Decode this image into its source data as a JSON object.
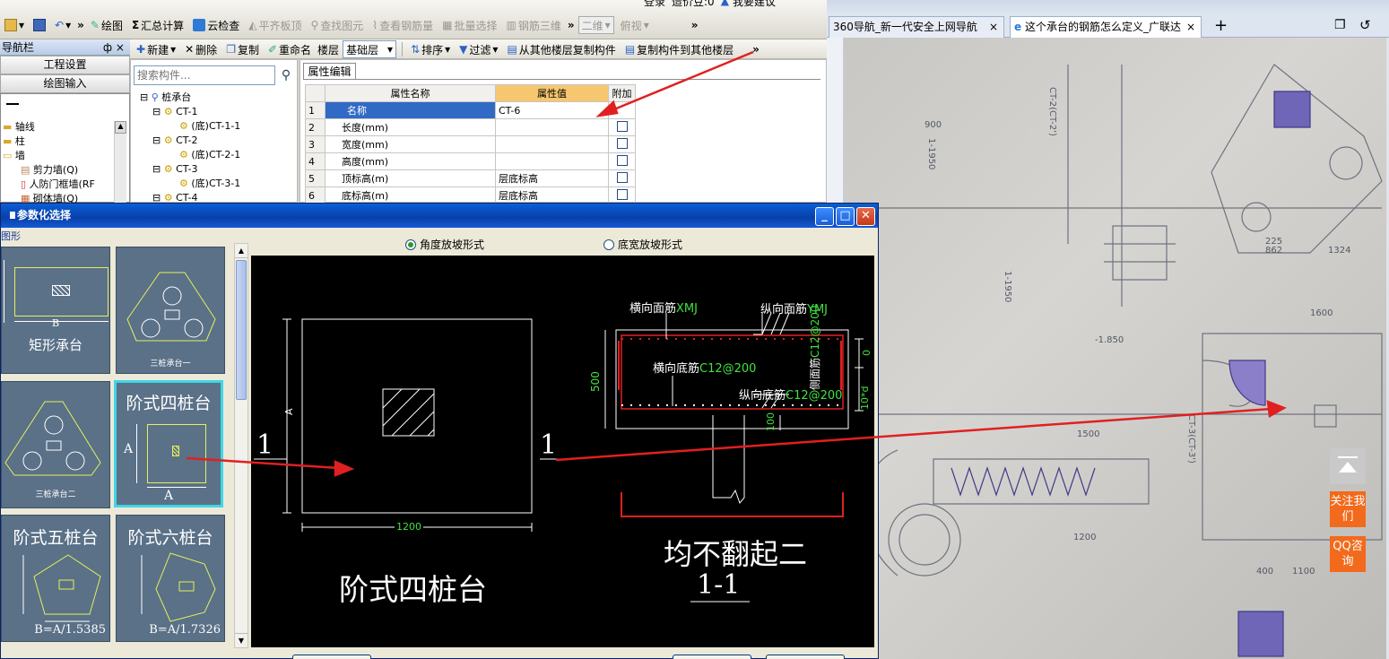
{
  "toolbar_top": {
    "row0": {
      "login_label": "登录",
      "price_label": "造价豆:0",
      "suggest_label": "我要建议"
    },
    "row1": {
      "draw": "绘图",
      "sum_calc": "汇总计算",
      "cloud_check": "云检查",
      "align_top": "平齐板顶",
      "find_elem": "查找图元",
      "view_rebar": "查看钢筋量",
      "batch_select": "批量选择",
      "rebar_3d": "钢筋三维",
      "view_2d": "二维",
      "view_top": "俯视"
    },
    "row2": {
      "new": "新建",
      "delete": "删除",
      "copy": "复制",
      "rename": "重命名",
      "floor_label": "楼层",
      "floor_value": "基础层",
      "sort": "排序",
      "filter": "过滤",
      "copy_from": "从其他楼层复制构件",
      "copy_to": "复制构件到其他楼层"
    }
  },
  "nav": {
    "header": "导航栏",
    "header_pin": "ф ×",
    "btn_project": "工程设置",
    "btn_drawing": "绘图输入",
    "items": [
      "轴线",
      "柱",
      "墙",
      "剪力墙(Q)",
      "人防门框墙(RF",
      "砌体墙(Q)"
    ]
  },
  "search": {
    "placeholder": "搜索构件..."
  },
  "tree": {
    "root": "桩承台",
    "nodes": [
      "CT-1",
      "(底)CT-1-1",
      "CT-2",
      "(底)CT-2-1",
      "CT-3",
      "(底)CT-3-1",
      "CT-4"
    ]
  },
  "props": {
    "tab": "属性编辑",
    "headers": [
      "属性名称",
      "属性值",
      "附加"
    ],
    "rows": [
      {
        "n": "1",
        "name": "名称",
        "value": "CT-6"
      },
      {
        "n": "2",
        "name": "长度(mm)",
        "value": ""
      },
      {
        "n": "3",
        "name": "宽度(mm)",
        "value": ""
      },
      {
        "n": "4",
        "name": "高度(mm)",
        "value": ""
      },
      {
        "n": "5",
        "name": "顶标高(m)",
        "value": "层底标高"
      },
      {
        "n": "6",
        "name": "底标高(m)",
        "value": "层底标高"
      }
    ]
  },
  "dialog": {
    "title": "参数化选择",
    "group_label": "图形",
    "radio1": "角度放坡形式",
    "radio2": "底宽放坡形式",
    "thumbs": {
      "t1": "矩形承台",
      "t1_b": "B",
      "t2": "三桩承台一",
      "t3": "三桩承台二",
      "t4": "阶式四桩台",
      "t4_a": "A",
      "t5": "阶式五桩台",
      "t5_b": "B=A/1.5385",
      "t6": "阶式六桩台",
      "t6_b": "B=A/1.7326"
    },
    "cad": {
      "plan_dim": "1200",
      "section_mark": "1",
      "plan_title": "阶式四桩台",
      "xmj": "横向面筋",
      "xmj_code": "XMJ",
      "ymj": "纵向面筋",
      "ymj_code": "YMJ",
      "xdj": "横向底筋",
      "xdj_code": "C12@200",
      "ydj": "纵向底筋",
      "ydj_code": "C12@200",
      "side": "侧面筋",
      "side_code": "C12@200",
      "h500": "500",
      "d0": "0",
      "d10": "10*d",
      "d100": "100",
      "note": "均不翻起二",
      "sec_title": "1-1"
    }
  },
  "browser": {
    "tab1": "360导航_新一代安全上网导航",
    "tab2": "这个承台的钢筋怎么定义_广联达",
    "plus": "+",
    "photo_labels": [
      "CT-2(CT-2')",
      "CT-3(CT-3')",
      "1500",
      "1200",
      "1600",
      "400",
      "1100",
      "225",
      "862",
      "1324",
      "900",
      "1-1950",
      "-1.850",
      "1-1950"
    ]
  },
  "side_buttons": {
    "follow": "关注我们",
    "qq": "QQ咨询"
  },
  "colors": {
    "accent_red": "#e02020",
    "cad_green": "#3fe33f",
    "sel_cyan": "#3fd6e6",
    "orange": "#f26a1b"
  }
}
